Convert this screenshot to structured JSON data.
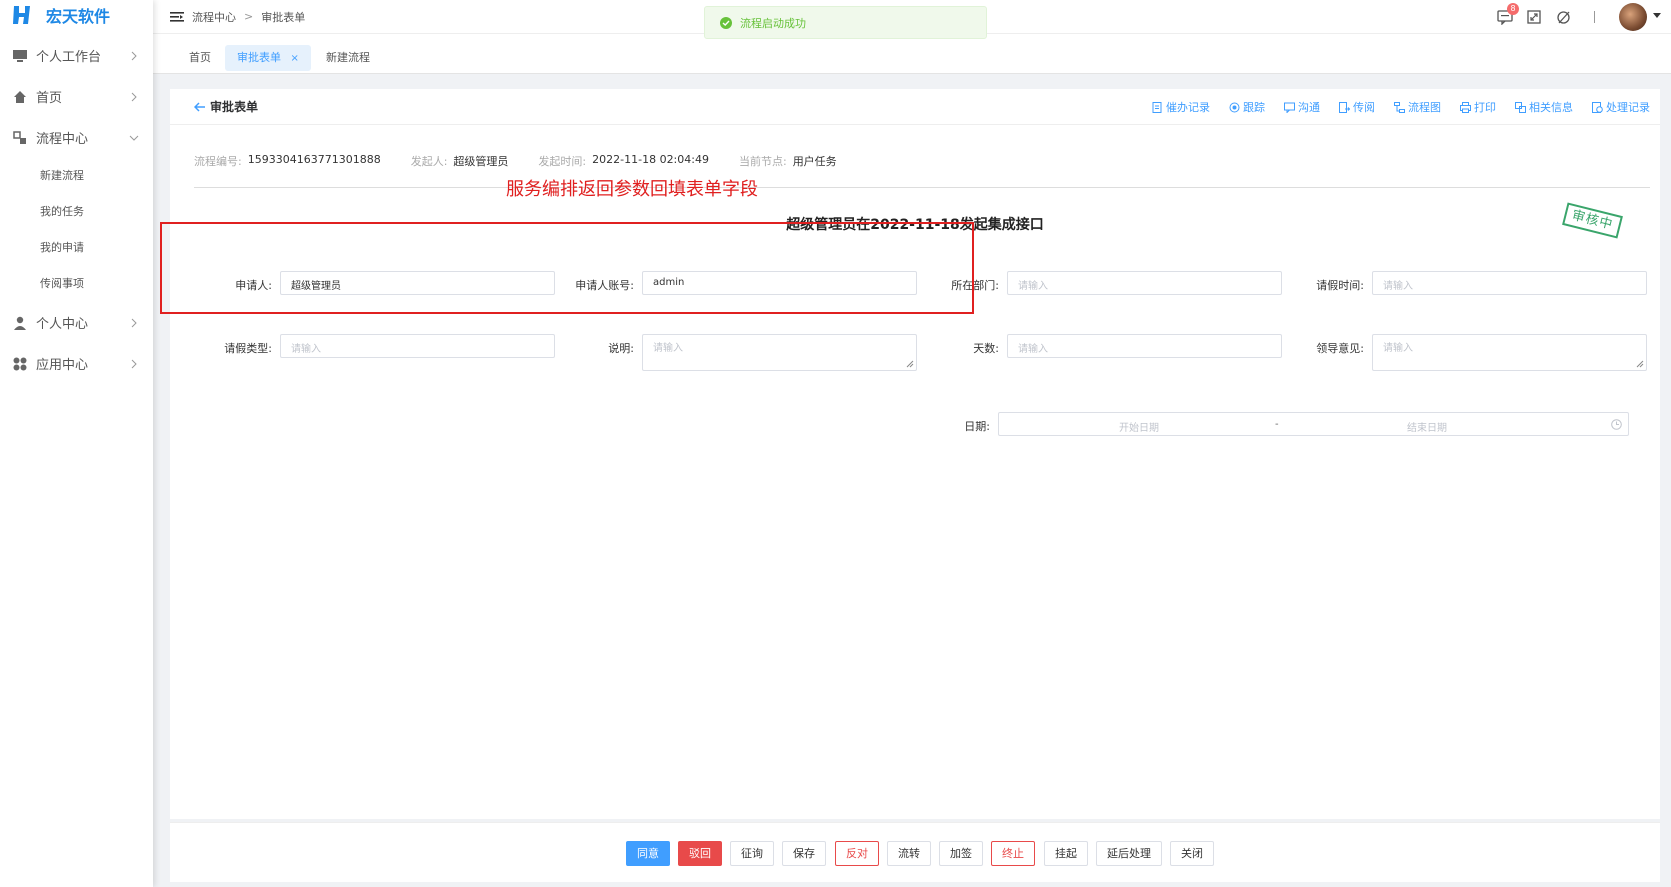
{
  "app": {
    "brand": "宏天软件",
    "colors": {
      "primary": "#409eff",
      "danger": "#e84a4a",
      "success": "#67c23a",
      "annotation": "#e02020",
      "stamp": "#3aa56b"
    }
  },
  "sidebar": {
    "items": [
      {
        "label": "个人工作台",
        "icon": "monitor-icon"
      },
      {
        "label": "首页",
        "icon": "home-icon"
      },
      {
        "label": "流程中心",
        "icon": "flow-icon",
        "expanded": true,
        "children": [
          "新建流程",
          "我的任务",
          "我的申请",
          "传阅事项"
        ]
      },
      {
        "label": "个人中心",
        "icon": "user-icon"
      },
      {
        "label": "应用中心",
        "icon": "apps-icon"
      }
    ]
  },
  "header": {
    "breadcrumb": [
      "流程中心",
      "审批表单"
    ],
    "breadcrumb_sep": ">",
    "notification_count": "8"
  },
  "tabs": [
    {
      "label": "首页",
      "active": false
    },
    {
      "label": "审批表单",
      "active": true,
      "close": "×"
    },
    {
      "label": "新建流程",
      "active": false
    }
  ],
  "toast": {
    "message": "流程启动成功"
  },
  "card": {
    "title": "审批表单",
    "actions": [
      "催办记录",
      "跟踪",
      "沟通",
      "传阅",
      "流程图",
      "打印",
      "相关信息",
      "处理记录"
    ],
    "info": {
      "process_no_label": "流程编号:",
      "process_no": "1593304163771301888",
      "initiator_label": "发起人:",
      "initiator": "超级管理员",
      "time_label": "发起时间:",
      "time": "2022-11-18 02:04:49",
      "node_label": "当前节点:",
      "node": "用户任务"
    },
    "annotation": "服务编排返回参数回填表单字段",
    "form_title": "超级管理员在2022-11-18发起集成接口",
    "stamp": "审核中",
    "fields": {
      "applicant": {
        "label": "申请人:",
        "value": "超级管理员"
      },
      "account": {
        "label": "申请人账号:",
        "value": "admin"
      },
      "dept": {
        "label": "所在部门:",
        "placeholder": "请输入"
      },
      "leave_time": {
        "label": "请假时间:",
        "placeholder": "请输入"
      },
      "leave_type": {
        "label": "请假类型:",
        "placeholder": "请输入"
      },
      "desc": {
        "label": "说明:",
        "placeholder": "请输入"
      },
      "days": {
        "label": "天数:",
        "placeholder": "请输入"
      },
      "opinion": {
        "label": "领导意见:",
        "placeholder": "请输入"
      },
      "date": {
        "label": "日期:",
        "start_placeholder": "开始日期",
        "sep": "-",
        "end_placeholder": "结束日期"
      }
    }
  },
  "footer": {
    "buttons": [
      "同意",
      "驳回",
      "征询",
      "保存",
      "反对",
      "流转",
      "加签",
      "终止",
      "挂起",
      "延后处理",
      "关闭"
    ]
  }
}
